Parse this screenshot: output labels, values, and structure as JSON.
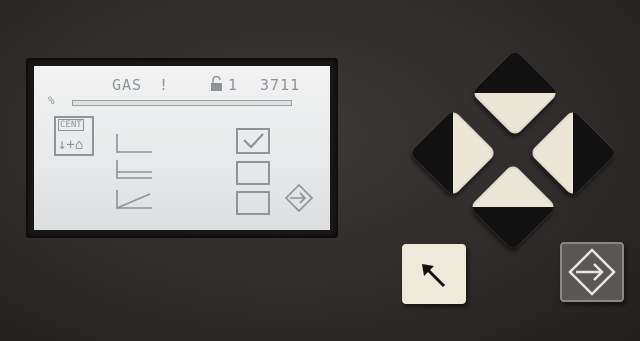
{
  "display": {
    "label": "GAS",
    "alert_mark": "!",
    "lock_count": "1",
    "code": "3711",
    "percent_sign": "%",
    "tile_text": "CENT",
    "tile_symbols": "↓+⌂",
    "level_fraction": 1.0
  },
  "options": [
    {
      "name": "flat",
      "checked": true
    },
    {
      "name": "double-flat",
      "checked": false
    },
    {
      "name": "slope",
      "checked": false
    }
  ],
  "icons": {
    "lock": "lock-icon",
    "confirm_arrow": "enter-arrow-icon",
    "back_arrow": "back-arrow-icon"
  },
  "colors": {
    "lcd_background": "#ecedee",
    "lcd_ink": "#8e9498",
    "button_face": "#ece6d6",
    "enter_button": "#5a5857"
  }
}
